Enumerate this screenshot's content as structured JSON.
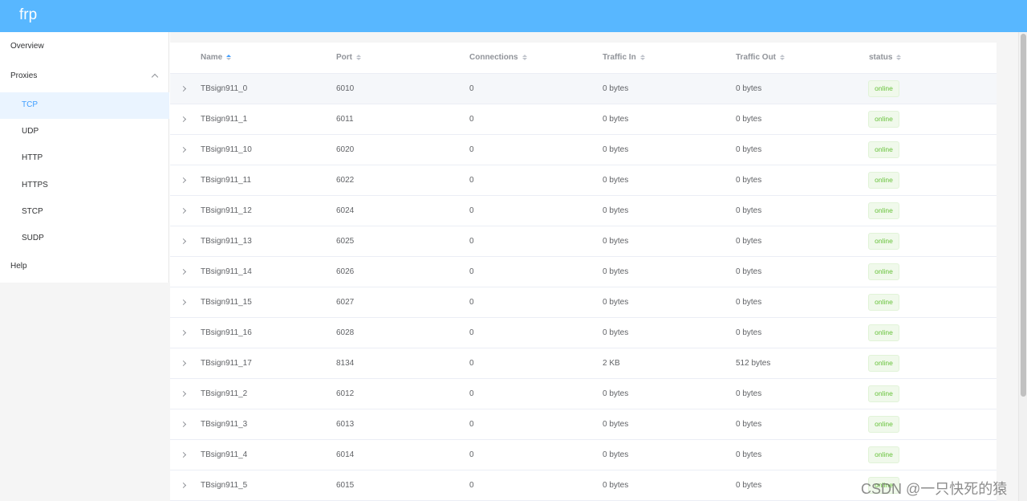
{
  "app": {
    "title": "frp"
  },
  "sidebar": {
    "overview": "Overview",
    "proxies": "Proxies",
    "sub_items": [
      "TCP",
      "UDP",
      "HTTP",
      "HTTPS",
      "STCP",
      "SUDP"
    ],
    "help": "Help"
  },
  "table": {
    "headers": [
      "Name",
      "Port",
      "Connections",
      "Traffic In",
      "Traffic Out",
      "status"
    ],
    "rows": [
      {
        "name": "TBsign911_0",
        "port": "6010",
        "conns": "0",
        "in": "0 bytes",
        "out": "0 bytes",
        "status": "online"
      },
      {
        "name": "TBsign911_1",
        "port": "6011",
        "conns": "0",
        "in": "0 bytes",
        "out": "0 bytes",
        "status": "online"
      },
      {
        "name": "TBsign911_10",
        "port": "6020",
        "conns": "0",
        "in": "0 bytes",
        "out": "0 bytes",
        "status": "online"
      },
      {
        "name": "TBsign911_11",
        "port": "6022",
        "conns": "0",
        "in": "0 bytes",
        "out": "0 bytes",
        "status": "online"
      },
      {
        "name": "TBsign911_12",
        "port": "6024",
        "conns": "0",
        "in": "0 bytes",
        "out": "0 bytes",
        "status": "online"
      },
      {
        "name": "TBsign911_13",
        "port": "6025",
        "conns": "0",
        "in": "0 bytes",
        "out": "0 bytes",
        "status": "online"
      },
      {
        "name": "TBsign911_14",
        "port": "6026",
        "conns": "0",
        "in": "0 bytes",
        "out": "0 bytes",
        "status": "online"
      },
      {
        "name": "TBsign911_15",
        "port": "6027",
        "conns": "0",
        "in": "0 bytes",
        "out": "0 bytes",
        "status": "online"
      },
      {
        "name": "TBsign911_16",
        "port": "6028",
        "conns": "0",
        "in": "0 bytes",
        "out": "0 bytes",
        "status": "online"
      },
      {
        "name": "TBsign911_17",
        "port": "8134",
        "conns": "0",
        "in": "2 KB",
        "out": "512 bytes",
        "status": "online"
      },
      {
        "name": "TBsign911_2",
        "port": "6012",
        "conns": "0",
        "in": "0 bytes",
        "out": "0 bytes",
        "status": "online"
      },
      {
        "name": "TBsign911_3",
        "port": "6013",
        "conns": "0",
        "in": "0 bytes",
        "out": "0 bytes",
        "status": "online"
      },
      {
        "name": "TBsign911_4",
        "port": "6014",
        "conns": "0",
        "in": "0 bytes",
        "out": "0 bytes",
        "status": "online"
      },
      {
        "name": "TBsign911_5",
        "port": "6015",
        "conns": "0",
        "in": "0 bytes",
        "out": "0 bytes",
        "status": "online"
      }
    ]
  },
  "watermark": "CSDN @一只快死的猿",
  "colors": {
    "header": "#58b7ff",
    "accent": "#409eff",
    "online": "#67c23a"
  }
}
